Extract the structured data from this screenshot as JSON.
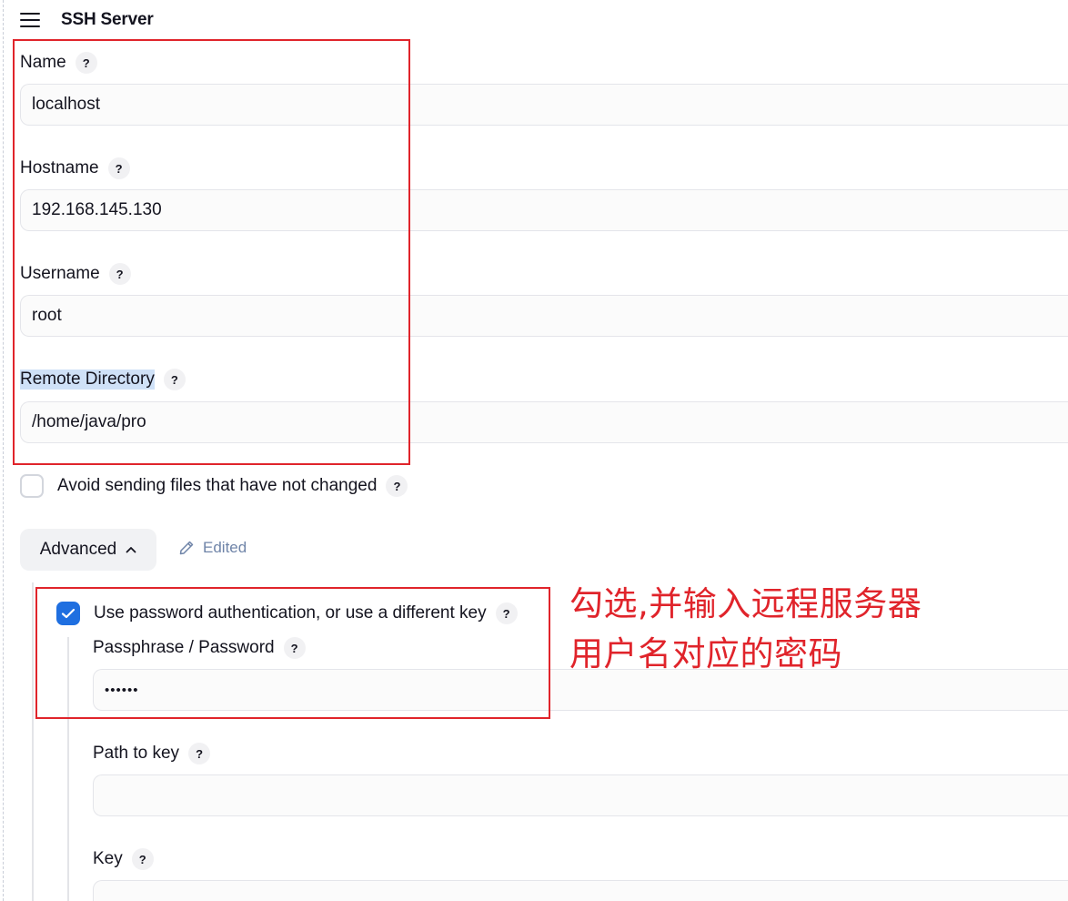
{
  "header": {
    "menu_icon": "hamburger-menu-icon",
    "title": "SSH Server"
  },
  "fields": {
    "name": {
      "label": "Name",
      "value": "localhost"
    },
    "hostname": {
      "label": "Hostname",
      "value": "192.168.145.130"
    },
    "username": {
      "label": "Username",
      "value": "root"
    },
    "remote_directory": {
      "label": "Remote Directory",
      "value": "/home/java/pro"
    }
  },
  "avoid_sending": {
    "label": "Avoid sending files that have not changed",
    "checked": false
  },
  "advanced": {
    "button_label": "Advanced",
    "edited_label": "Edited",
    "use_password": {
      "label": "Use password authentication, or use a different key",
      "checked": true
    },
    "passphrase": {
      "label": "Passphrase / Password",
      "value": "••••••"
    },
    "path_to_key": {
      "label": "Path to key",
      "value": ""
    },
    "key": {
      "label": "Key",
      "value": ""
    }
  },
  "help_glyph": "?",
  "annotation": {
    "line1": "勾选,并输入远程服务器",
    "line2": "用户名对应的密码",
    "color": "#e0242b"
  },
  "colors": {
    "accent": "#1f6fe0",
    "highlight": "#cfe1f7",
    "edited_text": "#6f84a8"
  }
}
